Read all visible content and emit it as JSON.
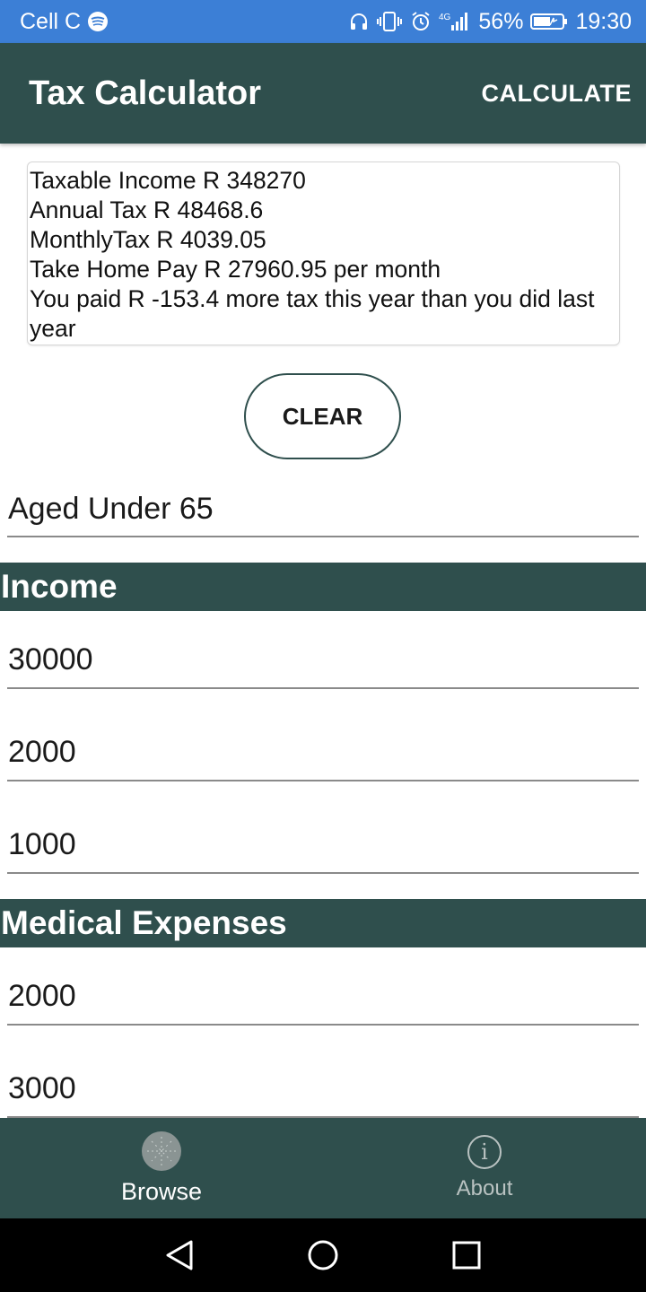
{
  "status_bar": {
    "carrier": "Cell C",
    "network": "4G",
    "battery": "56%",
    "time": "19:30",
    "icons": [
      "spotify-icon",
      "headphones-icon",
      "vibrate-icon",
      "alarm-icon",
      "signal-icon",
      "battery-icon"
    ]
  },
  "app_bar": {
    "title": "Tax Calculator",
    "action_label": "CALCULATE"
  },
  "results": {
    "lines": [
      "Taxable Income R 348270",
      "Annual Tax R 48468.6",
      "MonthlyTax R 4039.05",
      "Take Home Pay R 27960.95 per month",
      "You paid R -153.4 more tax this year than you did last year"
    ]
  },
  "clear_button_label": "CLEAR",
  "age_select": {
    "value": "Aged Under 65"
  },
  "sections": {
    "income": {
      "title": "Income",
      "fields": [
        "30000",
        "2000",
        "1000"
      ]
    },
    "medical": {
      "title": "Medical Expenses",
      "fields": [
        "2000",
        "3000"
      ]
    }
  },
  "bottom_nav": {
    "items": [
      {
        "label": "Browse",
        "icon": "browse-icon",
        "active": true
      },
      {
        "label": "About",
        "icon": "info-icon",
        "active": false
      }
    ]
  },
  "colors": {
    "status_bar": "#3c7fd6",
    "primary": "#2f4f4d",
    "nav_inactive": "#b9c2c1"
  }
}
